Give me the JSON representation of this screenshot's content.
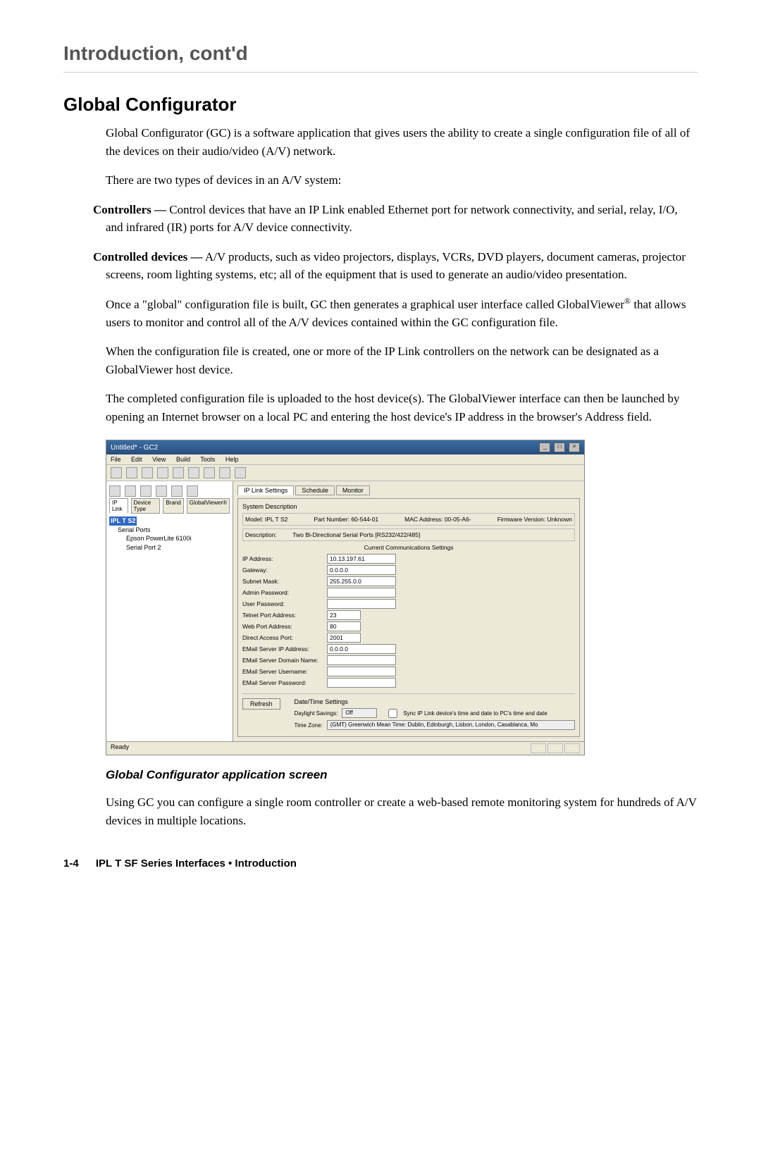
{
  "chapter_title": "Introduction, cont'd",
  "section_title": "Global Configurator",
  "para1": "Global Configurator (GC) is a software application that gives users the ability to create a single configuration file of all of the devices on their audio/video (A/V) network.",
  "para2": "There are two types of devices in an A/V system:",
  "def1_term": "Controllers —",
  "def1_body": " Control devices that have an IP Link enabled Ethernet port for network connectivity, and serial, relay, I/O, and infrared (IR) ports for A/V device connectivity.",
  "def2_term": "Controlled devices —",
  "def2_body": " A/V products, such as video projectors, displays, VCRs, DVD players, document cameras, projector screens, room lighting systems, etc;  all of the equipment that is used to generate an audio/video presentation.",
  "para3a": "Once a \"global\" configuration file is built, GC then generates a graphical user interface called GlobalViewer",
  "para3b": " that allows users to monitor and control all of the A/V devices contained within the GC configuration file.",
  "para4": "When the configuration file is created, one or more of the IP Link controllers on the network can be designated as a GlobalViewer host device.",
  "para5": "The completed configuration file is uploaded to the host device(s).  The GlobalViewer interface can then be launched by opening an Internet browser on a local PC and entering the host device's IP address in the browser's Address field.",
  "caption": "Global Configurator application screen",
  "para6": "Using GC you can configure a single room controller or create a web-based remote monitoring system for hundreds of A/V devices in multiple locations.",
  "footer_pagenum": "1-4",
  "footer_text": "IPL T SF Series Interfaces • Introduction",
  "screenshot": {
    "title": "Untitled* - GC2",
    "menus": [
      "File",
      "Edit",
      "View",
      "Build",
      "Tools",
      "Help"
    ],
    "left_tabs": [
      "IP Link",
      "Device Type",
      "Brand",
      "GlobalViewer®"
    ],
    "tree": {
      "root": "IPL T S2",
      "child1": "Serial Ports",
      "child2": "Epson PowerLite 6100i",
      "child3": "Serial Port 2"
    },
    "right_tabs": [
      "IP Link Settings",
      "Schedule",
      "Monitor"
    ],
    "system_desc_label": "System Description",
    "info": {
      "model_label": "Model:",
      "model": "IPL T S2",
      "part_label": "Part Number:",
      "part": "60-544-01",
      "mac_label": "MAC Address:",
      "mac": "00-05-A6-",
      "fw_label": "Firmware Version:",
      "fw": "Unknown",
      "desc_label": "Description:",
      "desc": "Two Bi-Directional Serial Ports [RS232/422/485]"
    },
    "comm_header": "Current Communications Settings",
    "fields": {
      "ip_label": "IP Address:",
      "ip": "10.13.197.61",
      "gw_label": "Gateway:",
      "gw": "0.0.0.0",
      "subnet_label": "Subnet Mask:",
      "subnet": "255.255.0.0",
      "admin_pw_label": "Admin Password:",
      "admin_pw": "",
      "user_pw_label": "User Password:",
      "user_pw": "",
      "telnet_label": "Telnet Port Address:",
      "telnet": "23",
      "web_label": "Web Port Address:",
      "web": "80",
      "direct_label": "Direct Access Port:",
      "direct": "2001",
      "email_ip_label": "EMail Server IP Address:",
      "email_ip": "0.0.0.0",
      "email_domain_label": "EMail Server Domain Name:",
      "email_domain": "",
      "email_user_label": "EMail Server Username:",
      "email_user": "",
      "email_pw_label": "EMail Server Password:",
      "email_pw": ""
    },
    "datetime": {
      "header": "Date/Time Settings",
      "daylight_label": "Daylight Savings:",
      "daylight_value": "Off",
      "sync_label": "Sync IP Link device's time and date to PC's time and date",
      "tz_label": "Time Zone:",
      "tz_value": "(GMT) Greenwich Mean Time: Dublin, Edinburgh, Lisbon, London, Casablanca, Mo"
    },
    "refresh": "Refresh",
    "status": "Ready"
  }
}
